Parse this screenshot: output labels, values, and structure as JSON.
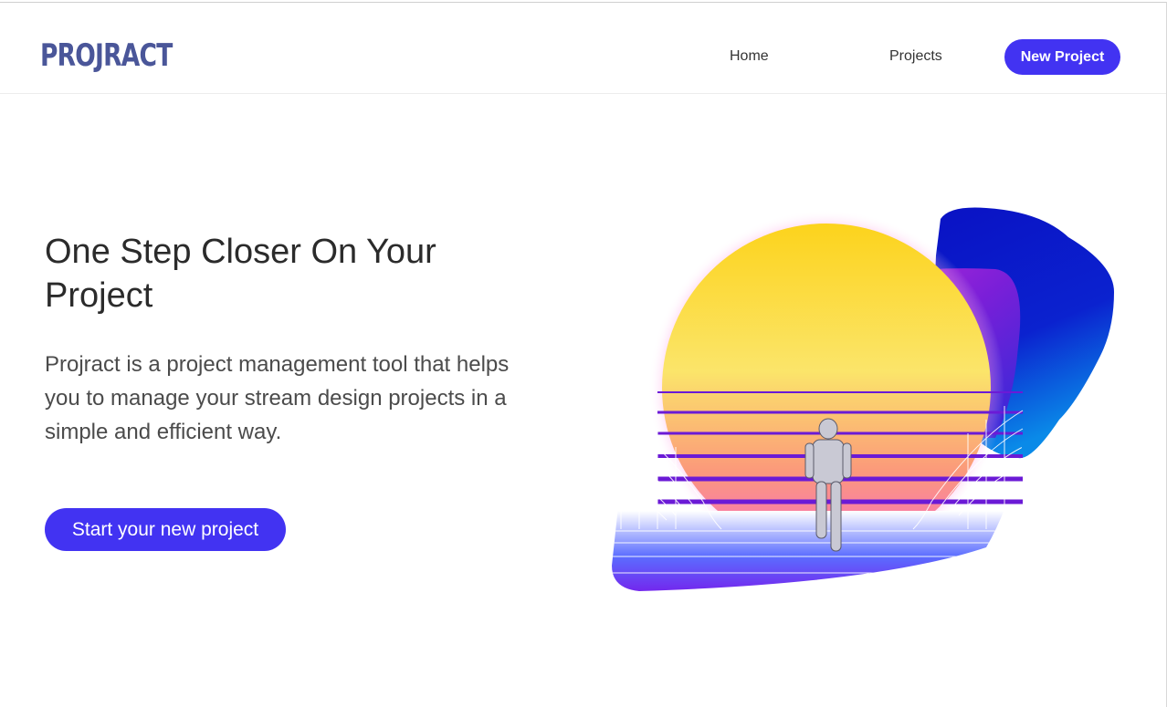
{
  "brand": {
    "logo_text": "PROJRACT"
  },
  "nav": {
    "home_label": "Home",
    "projects_label": "Projects",
    "new_project_label": "New Project"
  },
  "hero": {
    "title": "One Step Closer On Your Project",
    "description": "Projract is a project management tool that helps you to manage your stream design projects in a simple and efficient way.",
    "cta_label": "Start your new project"
  },
  "colors": {
    "accent": "#4233f2",
    "logo": "#4a5699",
    "art_blue": "#0a12c4",
    "art_purple": "#7a1fd8",
    "art_sun": "#f7d21e",
    "art_pink": "#ff3fc8"
  }
}
